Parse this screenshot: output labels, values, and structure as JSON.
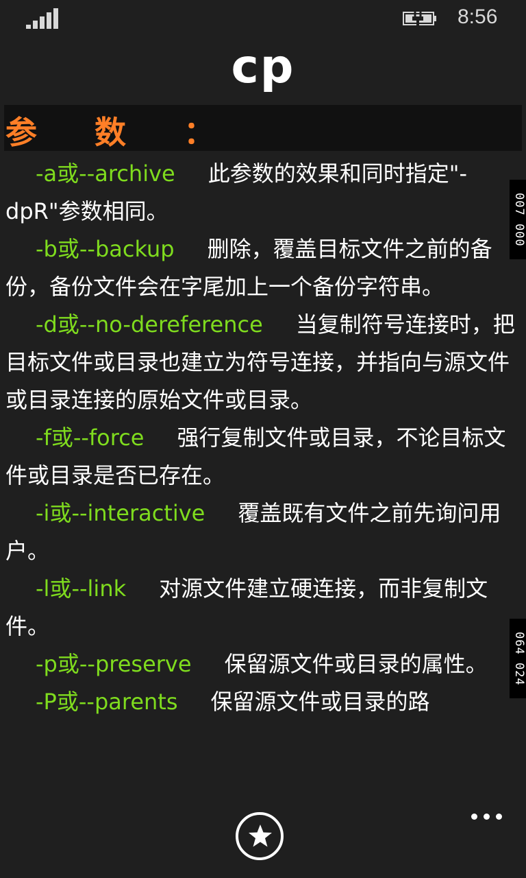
{
  "status_bar": {
    "time": "8:56",
    "signal_icon": "signal-strength-icon",
    "battery_icon": "battery-charging-icon"
  },
  "title": "cp",
  "section_label": "参数：",
  "options": [
    {
      "flag": "-a或--archive",
      "desc": "此参数的效果和同时指定\"-dpR\"参数相同。"
    },
    {
      "flag": "-b或--backup",
      "desc": "删除，覆盖目标文件之前的备份，备份文件会在字尾加上一个备份字符串。"
    },
    {
      "flag": "-d或--no-dereference",
      "desc": "当复制符号连接时，把目标文件或目录也建立为符号连接，并指向与源文件或目录连接的原始文件或目录。"
    },
    {
      "flag": "-f或--force",
      "desc": "强行复制文件或目录，不论目标文件或目录是否已存在。"
    },
    {
      "flag": "-i或--interactive",
      "desc": "覆盖既有文件之前先询问用户。"
    },
    {
      "flag": "-l或--link",
      "desc": "对源文件建立硬连接，而非复制文件。"
    },
    {
      "flag": "-p或--preserve",
      "desc": "保留源文件或目录的属性。"
    },
    {
      "flag": "-P或--parents",
      "desc": "保留源文件或目录的路"
    }
  ],
  "side_markers": [
    "007 000",
    "064 024"
  ],
  "app_bar": {
    "favorite_icon": "star-icon",
    "more_icon": "more-icon"
  },
  "colors": {
    "background": "#1f1f1f",
    "accent_orange": "#ff7f27",
    "option_green": "#7fdc1e"
  }
}
